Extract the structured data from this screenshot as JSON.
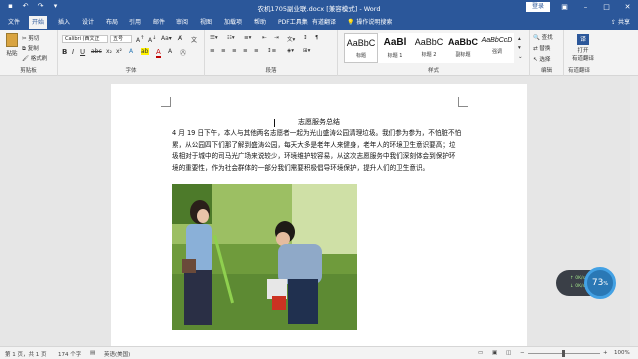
{
  "titlebar": {
    "doc_title": "农机1705副业联.docx [兼容模式] - Word",
    "login": "登录",
    "quick_access": [
      "save-icon",
      "undo-icon",
      "redo-icon",
      "customize-icon"
    ]
  },
  "tabs": [
    "文件",
    "开始",
    "插入",
    "设计",
    "布局",
    "引用",
    "邮件",
    "审阅",
    "视图",
    "加载项",
    "帮助",
    "PDF工具集",
    "有道翻译"
  ],
  "tell_me": "操作说明搜索",
  "share": "共享",
  "ribbon": {
    "clipboard": {
      "paste": "粘贴",
      "cut": "剪切",
      "copy": "复制",
      "format_painter": "格式刷",
      "label": "剪贴板"
    },
    "font": {
      "font_name": "Calibri (西文正",
      "font_size": "五号",
      "label": "字体"
    },
    "paragraph": {
      "label": "段落"
    },
    "styles": {
      "items": [
        {
          "preview": "AaBbC",
          "name": "标题"
        },
        {
          "preview": "AaBl",
          "name": "标题 1"
        },
        {
          "preview": "AaBbC",
          "name": "标题 2"
        },
        {
          "preview": "AaBbC",
          "name": "副标题"
        },
        {
          "preview": "AaBbCcD",
          "name": "强调"
        }
      ],
      "label": "样式"
    },
    "editing": {
      "find": "查找",
      "replace": "替换",
      "select": "选择",
      "label": "编辑"
    },
    "translate": {
      "open": "打开",
      "name": "有道翻译",
      "label": "有道翻译"
    }
  },
  "document": {
    "title": "志愿服务总结",
    "paragraph": "4 月 19 日下午，本人与其他两名志愿者一起为光山盛涛公园清理垃圾。我们参为参为，不怕脏不怕累，从公园四下们那了解到盛涛公园，每天大多是老年人来健身，老年人的环境卫生意识要高；垃圾相对于城中的司马光广场来说较少，环境维护较容易，从这次志愿服务中我们深刻体会到保护环境的重要性，作为社会群体的一部分我们需要积极倡导环境保护，提升人们的卫生意识。"
  },
  "widget": {
    "percent": "73",
    "unit": "%",
    "up": "0K/s",
    "down": "0K/s"
  },
  "statusbar": {
    "page": "第 1 页，共 1 页",
    "words": "174 个字",
    "language": "英语(美国)",
    "zoom": "100%"
  },
  "colors": {
    "word_blue": "#2b579a",
    "widget_blue": "#2a78b5"
  }
}
